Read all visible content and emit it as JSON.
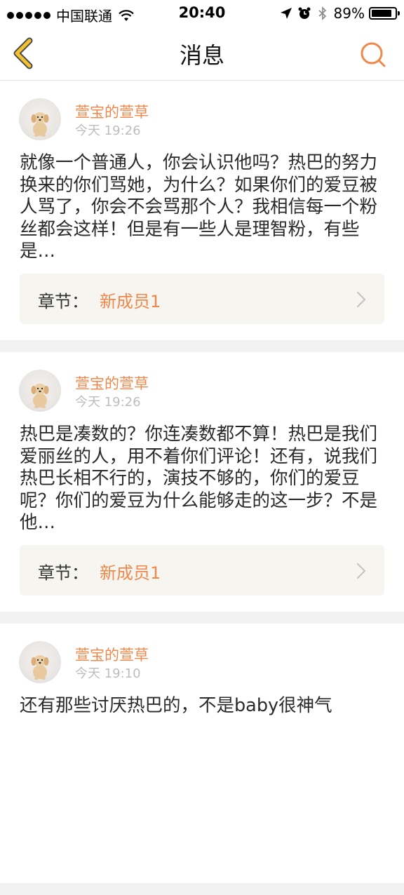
{
  "status_bar": {
    "carrier": "中国联通",
    "time": "20:40",
    "battery": "89%",
    "battery_level": 0.89
  },
  "nav": {
    "title": "消息",
    "back_icon": "chevron-left-icon",
    "search_icon": "search-icon"
  },
  "colors": {
    "accent": "#f0884c",
    "back_icon": "#f2c230"
  },
  "posts": [
    {
      "user": "萱宝的萱草",
      "time": "今天 19:26",
      "content": "就像一个普通人，你会认识他吗？热巴的努力换来的你们骂她，为什么？如果你们的爱豆被人骂了，你会不会骂那个人？我相信每一个粉丝都会这样！但是有一些人是理智粉，有些是…",
      "chapter_label": "章节：",
      "chapter_value": "新成员1"
    },
    {
      "user": "萱宝的萱草",
      "time": "今天 19:26",
      "content": "热巴是凑数的？你连凑数都不算！热巴是我们爱丽丝的人，用不着你们评论！还有，说我们热巴长相不行的，演技不够的，你们的爱豆呢？你们的爱豆为什么能够走的这一步？不是他…",
      "chapter_label": "章节：",
      "chapter_value": "新成员1"
    },
    {
      "user": "萱宝的萱草",
      "time": "今天 19:10",
      "content": "还有那些讨厌热巴的，不是baby很神气"
    }
  ]
}
